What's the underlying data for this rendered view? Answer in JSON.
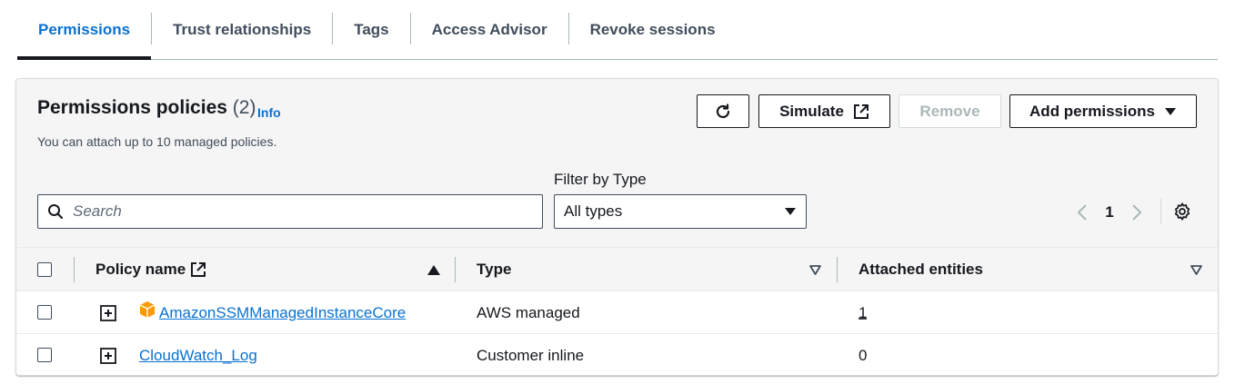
{
  "tabs": [
    {
      "label": "Permissions",
      "active": true
    },
    {
      "label": "Trust relationships"
    },
    {
      "label": "Tags"
    },
    {
      "label": "Access Advisor"
    },
    {
      "label": "Revoke sessions"
    }
  ],
  "panel": {
    "title": "Permissions policies",
    "count": "(2)",
    "info": "Info",
    "subtitle": "You can attach up to 10 managed policies.",
    "buttons": {
      "refresh_icon": "refresh-icon",
      "simulate": "Simulate",
      "remove": "Remove",
      "add_permissions": "Add permissions"
    },
    "filter_label": "Filter by Type",
    "search_placeholder": "Search",
    "filter_value": "All types",
    "page": "1"
  },
  "table": {
    "columns": [
      "Policy name",
      "Type",
      "Attached entities"
    ],
    "rows": [
      {
        "name": "AmazonSSMManagedInstanceCore",
        "type": "AWS managed",
        "entities": "1",
        "icon": "aws-managed-cube-icon"
      },
      {
        "name": "CloudWatch_Log",
        "type": "Customer inline",
        "entities": "0"
      }
    ]
  },
  "colors": {
    "accent": "#0972d3",
    "aws_orange": "#ff9900"
  }
}
